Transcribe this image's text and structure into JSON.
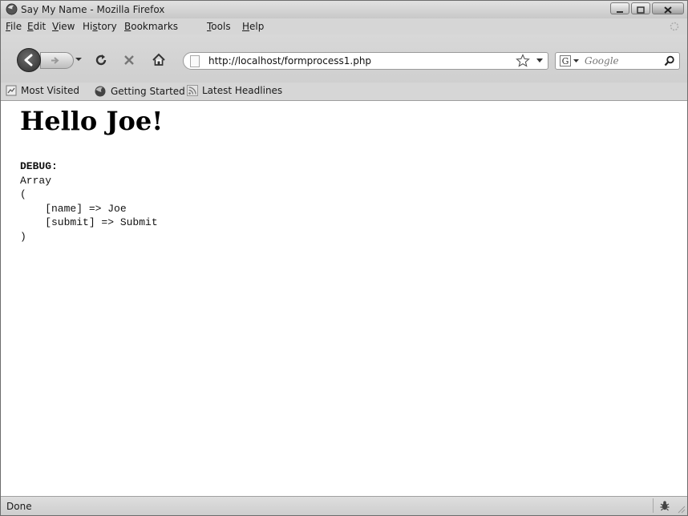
{
  "window": {
    "title": "Say My Name - Mozilla Firefox"
  },
  "menu": {
    "items": [
      {
        "acc": "F",
        "rest": "ile"
      },
      {
        "acc": "E",
        "rest": "dit"
      },
      {
        "acc": "V",
        "rest": "iew"
      },
      {
        "pre": "Hi",
        "acc": "s",
        "rest": "tory"
      },
      {
        "acc": "B",
        "rest": "ookmarks"
      },
      {
        "acc": "T",
        "rest": "ools"
      },
      {
        "acc": "H",
        "rest": "elp"
      }
    ]
  },
  "navigation": {
    "url": "http://localhost/formprocess1.php",
    "search_placeholder": "Google",
    "search_engine_letter": "G"
  },
  "bookmarks": {
    "items": [
      {
        "label": "Most Visited",
        "icon": "most-visited-icon"
      },
      {
        "label": "Getting Started",
        "icon": "firefox-icon"
      },
      {
        "label": "Latest Headlines",
        "icon": "rss-icon"
      }
    ]
  },
  "page": {
    "heading": "Hello Joe!",
    "debug_label": "DEBUG:",
    "debug_lines": [
      "Array",
      "(",
      "    [name] => Joe",
      "    [submit] => Submit",
      ")"
    ]
  },
  "status": {
    "text": "Done"
  }
}
